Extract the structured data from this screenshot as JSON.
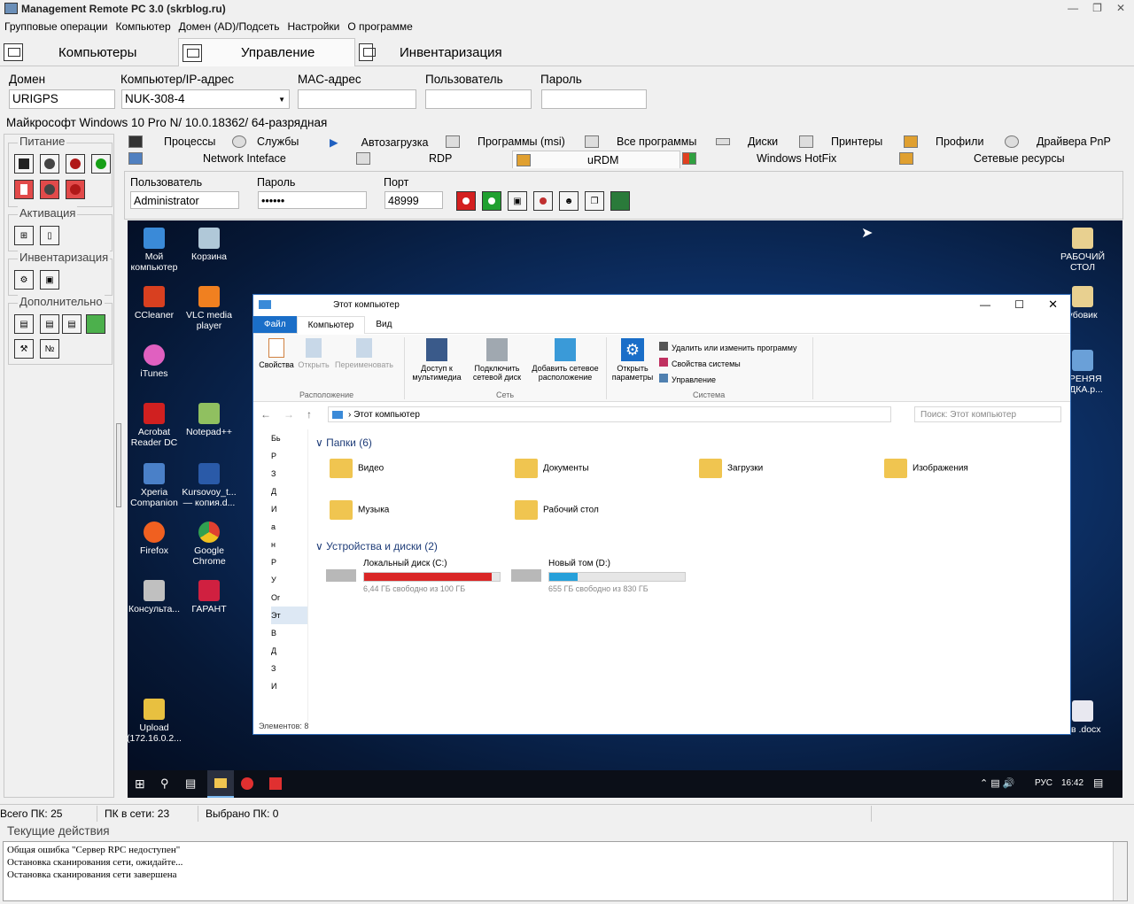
{
  "window": {
    "title": "Management Remote PC 3.0 (skrblog.ru)"
  },
  "menu": [
    "Групповые операции",
    "Компьютер",
    "Домен (AD)/Подсеть",
    "Настройки",
    "О программе"
  ],
  "main_tabs": [
    "Компьютеры",
    "Управление",
    "Инвентаризация"
  ],
  "fields": {
    "domain_label": "Домен",
    "domain_value": "URIGPS",
    "computer_label": "Компьютер/IP-адрес",
    "computer_value": "NUK-308-4",
    "mac_label": "MAC-адрес",
    "user_label": "Пользователь",
    "password_label": "Пароль"
  },
  "os_info": "Майкрософт Windows 10 Pro N/  10.0.18362/ 64-разрядная",
  "left_groups": [
    "Питание",
    "Активация",
    "Инвентаризация",
    "Дополнительно"
  ],
  "sub_tabs_row1": [
    "Процессы",
    "Службы",
    "Автозагрузка",
    "Программы (msi)",
    "Все программы",
    "Диски",
    "Принтеры",
    "Профили",
    "Драйвера PnP"
  ],
  "sub_tabs_row2": [
    "Network Inteface",
    "RDP",
    "uRDM",
    "Windows HotFix",
    "Сетевые ресурсы"
  ],
  "rdm": {
    "user_label": "Пользователь",
    "user_value": "Administrator",
    "password_label": "Пароль",
    "password_value": "••••••",
    "port_label": "Порт",
    "port_value": "48999"
  },
  "desktop_icons_left": [
    "Мой компьютер",
    "Корзина",
    "CCleaner",
    "VLC media player",
    "iTunes",
    "Acrobat Reader DC",
    "Notepad++",
    "Xperia Companion",
    "Kursovoy_t... — копия.d...",
    "Firefox",
    "Google Chrome",
    "Консульта...",
    "ГАРАНТ",
    "Upload (172.16.0.2..."
  ],
  "desktop_icons_right": [
    "РАБОЧИЙ СТОЛ",
    "убовик",
    "ТРЕНЯЯ ОДКА.р...",
    "ыв .docx"
  ],
  "explorer": {
    "title": "Этот компьютер",
    "ribbon_tabs": [
      "Файл",
      "Компьютер",
      "Вид"
    ],
    "ribbon_location": [
      "Свойства",
      "Открыть",
      "Переименовать"
    ],
    "ribbon_network": [
      "Доступ к мультимедиа",
      "Подключить сетевой диск",
      "Добавить сетевое расположение"
    ],
    "ribbon_open_params": "Открыть параметры",
    "ribbon_system": [
      "Удалить или изменить программу",
      "Свойства системы",
      "Управление"
    ],
    "group_labels": [
      "Расположение",
      "Сеть",
      "Система"
    ],
    "address": "Этот компьютер",
    "search_placeholder": "Поиск: Этот компьютер",
    "folders_header": "Папки (6)",
    "folders": [
      "Видео",
      "Документы",
      "Загрузки",
      "Изображения",
      "Музыка",
      "Рабочий стол"
    ],
    "drives_header": "Устройства и диски (2)",
    "drives": [
      {
        "name": "Локальный диск (C:)",
        "info": "6,44 ГБ свободно из 100 ГБ",
        "used": 0.94
      },
      {
        "name": "Новый том (D:)",
        "info": "655 ГБ свободно из 830 ГБ",
        "used": 0.21
      }
    ],
    "nav_items": [
      "Бь",
      "Р",
      "З",
      "Д",
      "И",
      "а",
      "н",
      "Р",
      "У",
      "Or",
      "Эт",
      "В",
      "Д",
      "З",
      "И"
    ],
    "status": "Элементов: 8"
  },
  "taskbar": {
    "lang": "РУС",
    "time": "16:42"
  },
  "status_bar": [
    "Всего ПК: 25",
    "ПК в сети: 23",
    "Выбрано ПК: 0"
  ],
  "log": {
    "title": "Текущие действия",
    "lines": [
      "Общая ошибка  \"Сервер RPC недоступен\"",
      "Остановка сканирования сети, ожидайте...",
      "Остановка сканирования сети завершена"
    ]
  }
}
